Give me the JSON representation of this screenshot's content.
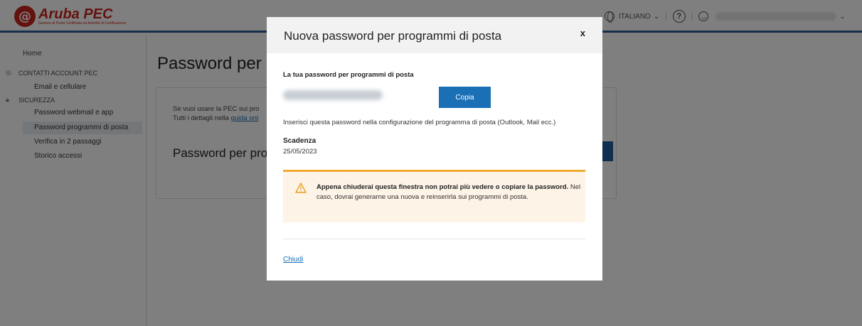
{
  "header": {
    "logo_name": "Aruba PEC",
    "logo_sub": "Gestore di Posta Certificata ed Autorità di Certificazione",
    "language": "ITALIANO",
    "help": "?"
  },
  "sidebar": {
    "home": "Home",
    "sections": [
      {
        "label": "CONTATTI ACCOUNT PEC",
        "icon": "user-circle-icon",
        "items": [
          {
            "label": "Email e cellulare"
          }
        ]
      },
      {
        "label": "SICUREZZA",
        "icon": "lock-icon",
        "items": [
          {
            "label": "Password webmail e app"
          },
          {
            "label": "Password programmi di posta",
            "active": true
          },
          {
            "label": "Verifica in 2 passaggi"
          },
          {
            "label": "Storico accessi"
          }
        ]
      }
    ]
  },
  "main": {
    "title": "Password per",
    "card_line1": "Se vuoi usare la PEC sui pro",
    "card_line2_prefix": "Tutti i dettagli nella ",
    "card_link": "guida onl",
    "card_subtitle": "Password per pro"
  },
  "modal": {
    "title": "Nuova password per programmi di posta",
    "close": "x",
    "password_label": "La tua password per programmi di posta",
    "copy_button": "Copia",
    "description": "Inserisci questa password nella configurazione del programma di posta (Outlook, Mail ecc.)",
    "expiry_label": "Scadenza",
    "expiry_value": "25/05/2023",
    "warning_bold": "Appena chiuderai questa finestra non potrai più vedere o copiare la password.",
    "warning_rest": " Nel caso, dovrai generarne una nuova e reinserirla sui programmi di posta.",
    "close_link": "Chiudi"
  },
  "colors": {
    "accent": "#1a6fb5",
    "header_border": "#2d5e94",
    "warning": "#f0a830",
    "brand": "#c8251c"
  }
}
